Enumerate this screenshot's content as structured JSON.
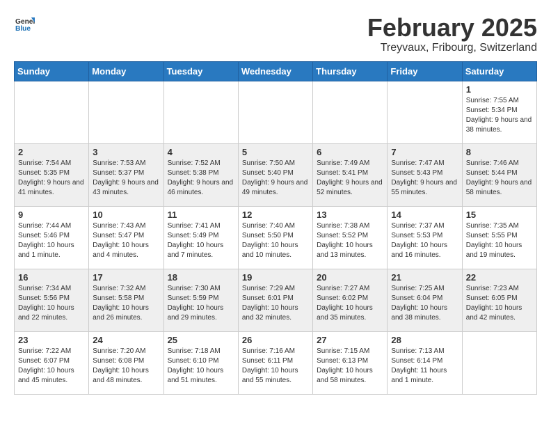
{
  "header": {
    "logo_general": "General",
    "logo_blue": "Blue",
    "title": "February 2025",
    "subtitle": "Treyvaux, Fribourg, Switzerland"
  },
  "columns": [
    "Sunday",
    "Monday",
    "Tuesday",
    "Wednesday",
    "Thursday",
    "Friday",
    "Saturday"
  ],
  "weeks": [
    {
      "id": "week1",
      "days": [
        {
          "num": "",
          "info": ""
        },
        {
          "num": "",
          "info": ""
        },
        {
          "num": "",
          "info": ""
        },
        {
          "num": "",
          "info": ""
        },
        {
          "num": "",
          "info": ""
        },
        {
          "num": "",
          "info": ""
        },
        {
          "num": "1",
          "info": "Sunrise: 7:55 AM\nSunset: 5:34 PM\nDaylight: 9 hours and 38 minutes."
        }
      ]
    },
    {
      "id": "week2",
      "days": [
        {
          "num": "2",
          "info": "Sunrise: 7:54 AM\nSunset: 5:35 PM\nDaylight: 9 hours and 41 minutes."
        },
        {
          "num": "3",
          "info": "Sunrise: 7:53 AM\nSunset: 5:37 PM\nDaylight: 9 hours and 43 minutes."
        },
        {
          "num": "4",
          "info": "Sunrise: 7:52 AM\nSunset: 5:38 PM\nDaylight: 9 hours and 46 minutes."
        },
        {
          "num": "5",
          "info": "Sunrise: 7:50 AM\nSunset: 5:40 PM\nDaylight: 9 hours and 49 minutes."
        },
        {
          "num": "6",
          "info": "Sunrise: 7:49 AM\nSunset: 5:41 PM\nDaylight: 9 hours and 52 minutes."
        },
        {
          "num": "7",
          "info": "Sunrise: 7:47 AM\nSunset: 5:43 PM\nDaylight: 9 hours and 55 minutes."
        },
        {
          "num": "8",
          "info": "Sunrise: 7:46 AM\nSunset: 5:44 PM\nDaylight: 9 hours and 58 minutes."
        }
      ]
    },
    {
      "id": "week3",
      "days": [
        {
          "num": "9",
          "info": "Sunrise: 7:44 AM\nSunset: 5:46 PM\nDaylight: 10 hours and 1 minute."
        },
        {
          "num": "10",
          "info": "Sunrise: 7:43 AM\nSunset: 5:47 PM\nDaylight: 10 hours and 4 minutes."
        },
        {
          "num": "11",
          "info": "Sunrise: 7:41 AM\nSunset: 5:49 PM\nDaylight: 10 hours and 7 minutes."
        },
        {
          "num": "12",
          "info": "Sunrise: 7:40 AM\nSunset: 5:50 PM\nDaylight: 10 hours and 10 minutes."
        },
        {
          "num": "13",
          "info": "Sunrise: 7:38 AM\nSunset: 5:52 PM\nDaylight: 10 hours and 13 minutes."
        },
        {
          "num": "14",
          "info": "Sunrise: 7:37 AM\nSunset: 5:53 PM\nDaylight: 10 hours and 16 minutes."
        },
        {
          "num": "15",
          "info": "Sunrise: 7:35 AM\nSunset: 5:55 PM\nDaylight: 10 hours and 19 minutes."
        }
      ]
    },
    {
      "id": "week4",
      "days": [
        {
          "num": "16",
          "info": "Sunrise: 7:34 AM\nSunset: 5:56 PM\nDaylight: 10 hours and 22 minutes."
        },
        {
          "num": "17",
          "info": "Sunrise: 7:32 AM\nSunset: 5:58 PM\nDaylight: 10 hours and 26 minutes."
        },
        {
          "num": "18",
          "info": "Sunrise: 7:30 AM\nSunset: 5:59 PM\nDaylight: 10 hours and 29 minutes."
        },
        {
          "num": "19",
          "info": "Sunrise: 7:29 AM\nSunset: 6:01 PM\nDaylight: 10 hours and 32 minutes."
        },
        {
          "num": "20",
          "info": "Sunrise: 7:27 AM\nSunset: 6:02 PM\nDaylight: 10 hours and 35 minutes."
        },
        {
          "num": "21",
          "info": "Sunrise: 7:25 AM\nSunset: 6:04 PM\nDaylight: 10 hours and 38 minutes."
        },
        {
          "num": "22",
          "info": "Sunrise: 7:23 AM\nSunset: 6:05 PM\nDaylight: 10 hours and 42 minutes."
        }
      ]
    },
    {
      "id": "week5",
      "days": [
        {
          "num": "23",
          "info": "Sunrise: 7:22 AM\nSunset: 6:07 PM\nDaylight: 10 hours and 45 minutes."
        },
        {
          "num": "24",
          "info": "Sunrise: 7:20 AM\nSunset: 6:08 PM\nDaylight: 10 hours and 48 minutes."
        },
        {
          "num": "25",
          "info": "Sunrise: 7:18 AM\nSunset: 6:10 PM\nDaylight: 10 hours and 51 minutes."
        },
        {
          "num": "26",
          "info": "Sunrise: 7:16 AM\nSunset: 6:11 PM\nDaylight: 10 hours and 55 minutes."
        },
        {
          "num": "27",
          "info": "Sunrise: 7:15 AM\nSunset: 6:13 PM\nDaylight: 10 hours and 58 minutes."
        },
        {
          "num": "28",
          "info": "Sunrise: 7:13 AM\nSunset: 6:14 PM\nDaylight: 11 hours and 1 minute."
        },
        {
          "num": "",
          "info": ""
        }
      ]
    }
  ]
}
